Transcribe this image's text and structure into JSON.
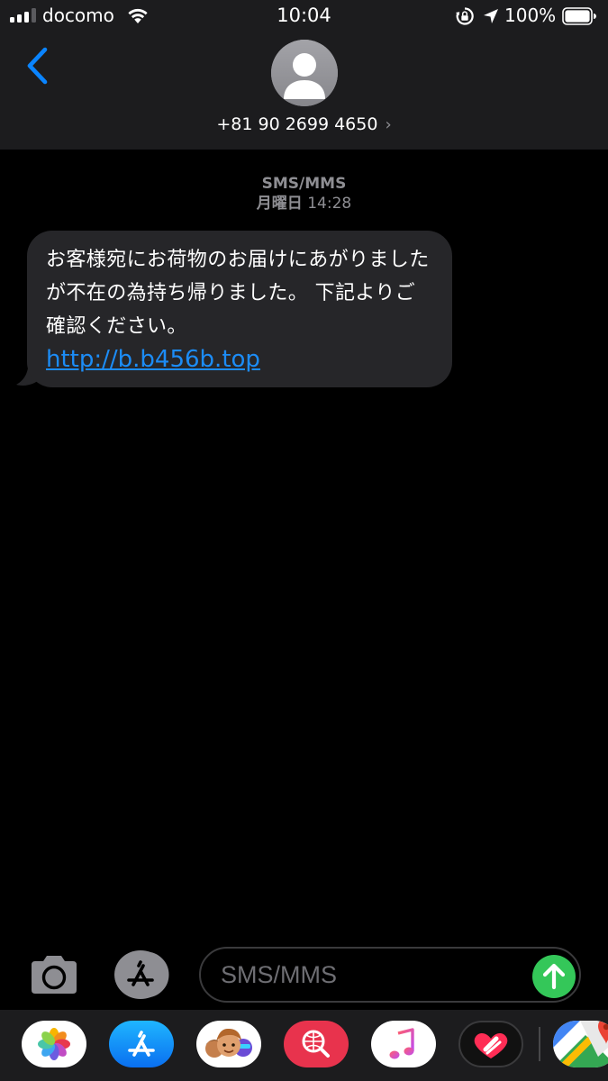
{
  "status_bar": {
    "carrier": "docomo",
    "time": "10:04",
    "battery_percent": "100%",
    "battery_level": 1.0,
    "signal_bars_active": 3,
    "signal_bars_total": 4
  },
  "contact": {
    "phone": "+81 90 2699 4650",
    "chevron": "›",
    "avatar_icon": "person-silhouette-icon"
  },
  "thread": {
    "service": "SMS/MMS",
    "day": "月曜日",
    "time": "14:28"
  },
  "messages": [
    {
      "direction": "incoming",
      "text": "お客様宛にお荷物のお届けにあがりましたが不在の為持ち帰りました。 下記よりご確認ください。",
      "link": "http://b.b456b.top"
    }
  ],
  "composer": {
    "placeholder": "SMS/MMS",
    "camera_icon": "camera-icon",
    "apps_icon": "app-store-icon",
    "send_icon": "arrow-up-icon"
  },
  "app_drawer": [
    {
      "name": "photos",
      "icon": "photos-icon"
    },
    {
      "name": "app-store",
      "icon": "app-store-icon"
    },
    {
      "name": "memoji",
      "icon": "memoji-stickers-icon"
    },
    {
      "name": "images-search",
      "icon": "globe-search-icon"
    },
    {
      "name": "music",
      "icon": "music-note-icon"
    },
    {
      "name": "digital-touch",
      "icon": "heart-touch-icon"
    },
    {
      "name": "google-maps",
      "icon": "map-pin-icon"
    }
  ],
  "colors": {
    "header_bg": "#1c1c1e",
    "bubble_bg": "#262629",
    "link": "#1c8cf6",
    "accent_blue": "#0a84ff",
    "send_green": "#34c759",
    "secondary_text": "#8e8e93"
  }
}
